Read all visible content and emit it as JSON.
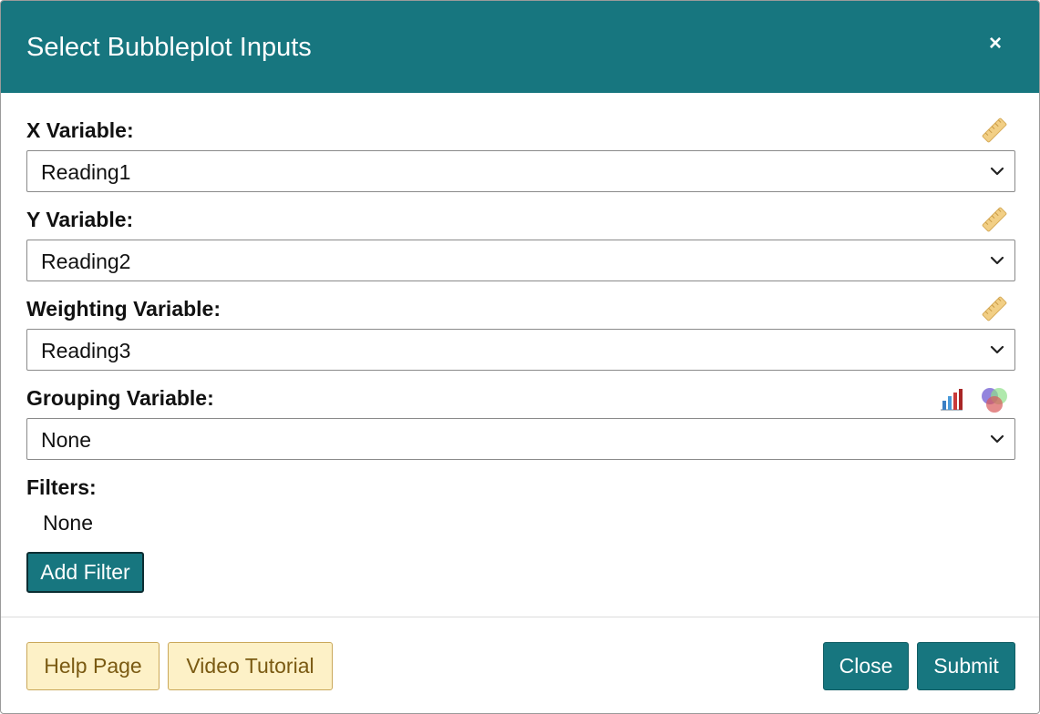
{
  "dialog": {
    "title": "Select Bubbleplot Inputs",
    "close_symbol": "×",
    "accent_color": "#17767f"
  },
  "fields": {
    "x": {
      "label": "X Variable:",
      "value": "Reading1",
      "icon": "ruler-icon"
    },
    "y": {
      "label": "Y Variable:",
      "value": "Reading2",
      "icon": "ruler-icon"
    },
    "weight": {
      "label": "Weighting Variable:",
      "value": "Reading3",
      "icon": "ruler-icon"
    },
    "group": {
      "label": "Grouping Variable:",
      "value": "None",
      "icons": [
        "bar-chart-icon",
        "venn-icon"
      ]
    }
  },
  "filters": {
    "label": "Filters:",
    "value": "None",
    "add_button": "Add Filter"
  },
  "footer": {
    "help": "Help Page",
    "video": "Video Tutorial",
    "close": "Close",
    "submit": "Submit"
  }
}
